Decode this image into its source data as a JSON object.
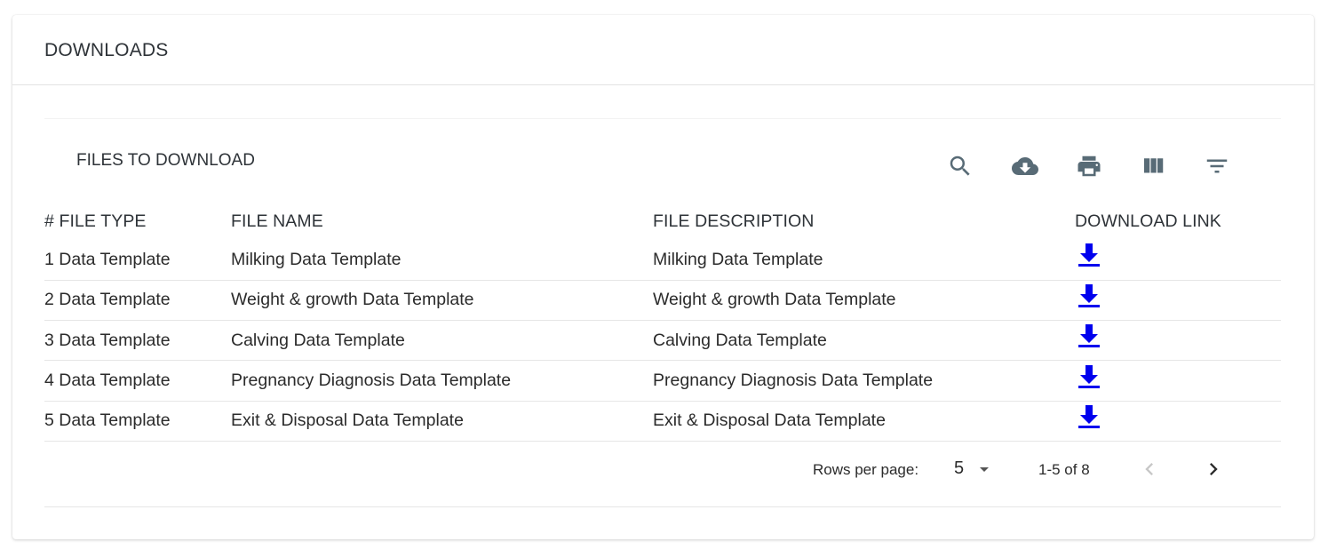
{
  "card": {
    "title": "DOWNLOADS"
  },
  "toolbar": {
    "title": "FILES TO DOWNLOAD",
    "icons": [
      "search-icon",
      "cloud-download-icon",
      "print-icon",
      "view-columns-icon",
      "filter-list-icon"
    ],
    "icon_color": "#586b76"
  },
  "table": {
    "headers": [
      "# FILE TYPE",
      "FILE NAME",
      "FILE DESCRIPTION",
      "DOWNLOAD LINK"
    ],
    "rows": [
      {
        "type": "1 Data Template",
        "name": "Milking Data Template",
        "description": "Milking Data Template"
      },
      {
        "type": "2 Data Template",
        "name": "Weight & growth Data Template",
        "description": "Weight & growth Data Template"
      },
      {
        "type": "3 Data Template",
        "name": "Calving Data Template",
        "description": "Calving Data Template"
      },
      {
        "type": "4 Data Template",
        "name": "Pregnancy Diagnosis Data Template",
        "description": "Pregnancy Diagnosis Data Template"
      },
      {
        "type": "5 Data Template",
        "name": "Exit & Disposal Data Template",
        "description": "Exit & Disposal Data Template"
      }
    ],
    "download_icon": "download-arrow-icon",
    "link_color": "#0000ee"
  },
  "pagination": {
    "rows_per_page_label": "Rows per page:",
    "rows_per_page_value": "5",
    "range": "1-5 of 8"
  }
}
